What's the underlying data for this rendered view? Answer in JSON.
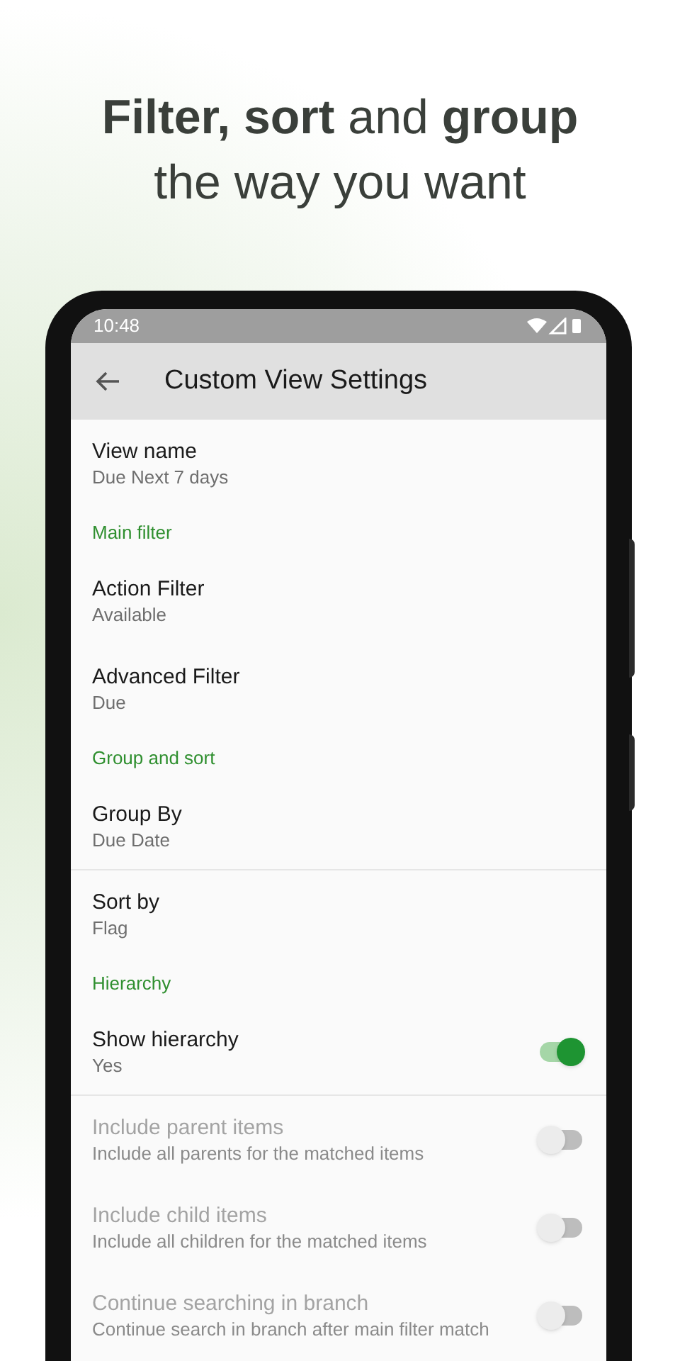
{
  "headline": {
    "line_1": "**Filter, sort** and **group**",
    "line_2": "the way you want"
  },
  "status_bar": {
    "time": "10:48"
  },
  "toolbar": {
    "title": "Custom View Settings"
  },
  "settings": [
    {
      "kind": "item",
      "title": "View name",
      "subtitle": "Due Next 7 days",
      "divider": false
    },
    {
      "kind": "header",
      "title": "Main filter"
    },
    {
      "kind": "item",
      "title": "Action Filter",
      "subtitle": "Available",
      "divider": false
    },
    {
      "kind": "item",
      "title": "Advanced Filter",
      "subtitle": "Due",
      "divider": false
    },
    {
      "kind": "header",
      "title": "Group and sort"
    },
    {
      "kind": "item",
      "title": "Group By",
      "subtitle": "Due Date",
      "divider": true
    },
    {
      "kind": "item",
      "title": "Sort by",
      "subtitle": "Flag",
      "divider": false
    },
    {
      "kind": "header",
      "title": "Hierarchy"
    },
    {
      "kind": "switch",
      "title": "Show hierarchy",
      "subtitle": "Yes",
      "on": true,
      "disabled": false,
      "divider": true
    },
    {
      "kind": "switch",
      "title": "Include parent items",
      "subtitle": "Include all parents for the matched items",
      "on": false,
      "disabled": true,
      "divider": false
    },
    {
      "kind": "switch",
      "title": "Include child items",
      "subtitle": "Include all children for the matched items",
      "on": false,
      "disabled": true,
      "divider": false
    },
    {
      "kind": "switch",
      "title": "Continue searching in branch",
      "subtitle": "Continue search in branch after main filter match",
      "on": false,
      "disabled": true,
      "divider": false
    }
  ]
}
